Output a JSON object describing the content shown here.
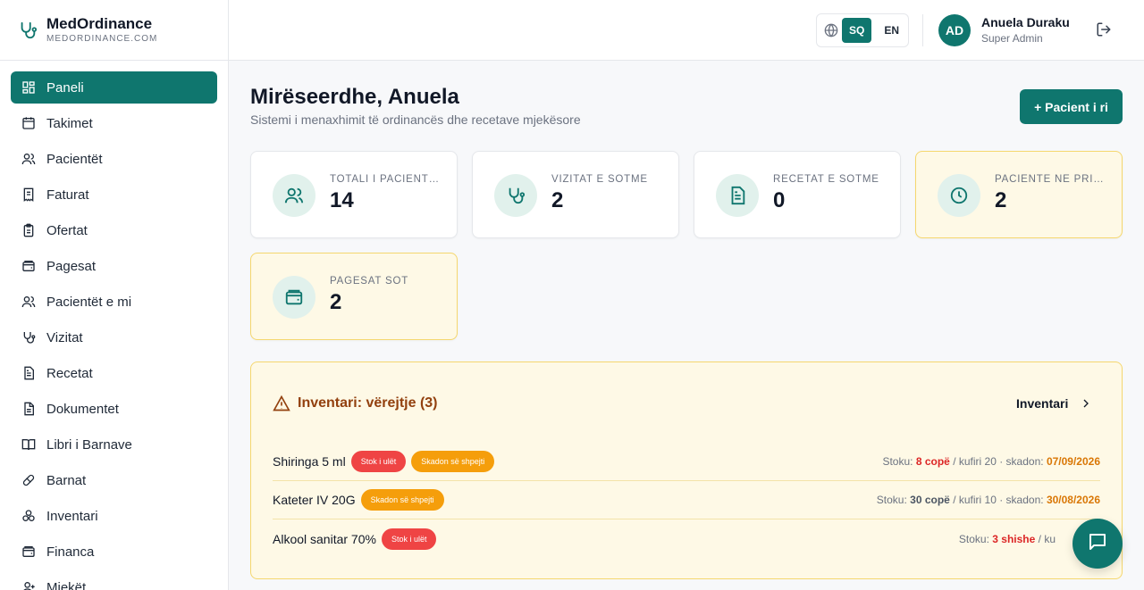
{
  "brand": {
    "name": "MedOrdinance",
    "domain": "MEDORDINANCE.COM"
  },
  "sidebar": {
    "items": [
      {
        "label": "Paneli",
        "icon": "dashboard-icon",
        "active": true
      },
      {
        "label": "Takimet",
        "icon": "calendar-icon"
      },
      {
        "label": "Pacientët",
        "icon": "users-icon"
      },
      {
        "label": "Faturat",
        "icon": "invoice-icon"
      },
      {
        "label": "Ofertat",
        "icon": "clipboard-icon"
      },
      {
        "label": "Pagesat",
        "icon": "wallet-icon"
      },
      {
        "label": "Pacientët e mi",
        "icon": "users-icon"
      },
      {
        "label": "Vizitat",
        "icon": "stethoscope-icon"
      },
      {
        "label": "Recetat",
        "icon": "document-icon"
      },
      {
        "label": "Dokumentet",
        "icon": "file-icon"
      },
      {
        "label": "Libri i Barnave",
        "icon": "book-icon"
      },
      {
        "label": "Barnat",
        "icon": "pill-icon"
      },
      {
        "label": "Inventari",
        "icon": "boxes-icon"
      },
      {
        "label": "Financa",
        "icon": "wallet-icon"
      },
      {
        "label": "Mjekët",
        "icon": "doctor-icon"
      }
    ]
  },
  "topbar": {
    "lang_active": "SQ",
    "lang_other": "EN",
    "avatar_initials": "AD",
    "user_name": "Anuela Duraku",
    "user_role": "Super Admin"
  },
  "main": {
    "welcome": "Mirëseerdhe, Anuela",
    "subtitle": "Sistemi i menaxhimit të ordinancës dhe recetave mjekësore",
    "new_patient_label": "+ Pacient i ri"
  },
  "stats": [
    {
      "label": "TOTALI I PACIENTËVE",
      "value": "14",
      "icon": "users-icon"
    },
    {
      "label": "VIZITAT E SOTME",
      "value": "2",
      "icon": "stethoscope-icon"
    },
    {
      "label": "RECETAT E SOTME",
      "value": "0",
      "icon": "document-icon"
    },
    {
      "label": "PACIENTË NË PRITJE",
      "value": "2",
      "icon": "clock-icon"
    },
    {
      "label": "PAGESAT SOT",
      "value": "2",
      "icon": "wallet-icon"
    }
  ],
  "inventory": {
    "title": "Inventari: vërejtje (3)",
    "link_label": "Inventari",
    "rows": [
      {
        "name": "Shiringa 5 ml",
        "badges": [
          "Stok i ulët",
          "Skadon së shpejti"
        ],
        "stock_label": "Stoku:",
        "qty": "8 copë",
        "limit": "/ kufiri 20 · skadon:",
        "expiry": "07/09/2026"
      },
      {
        "name": "Kateter IV 20G",
        "badges": [
          "Skadon së shpejti"
        ],
        "stock_label": "Stoku:",
        "qty": "30 copë",
        "limit": "/ kufiri 10 · skadon:",
        "expiry": "30/08/2026"
      },
      {
        "name": "Alkool sanitar 70%",
        "badges": [
          "Stok i ulët"
        ],
        "stock_label": "Stoku:",
        "qty": "3 shishe",
        "limit": "/ ku",
        "expiry": ""
      }
    ]
  },
  "colors": {
    "primary": "#0f766e",
    "warn_bg": "#fef9e6",
    "badge_red": "#ef4444",
    "badge_amber": "#f59e0b"
  }
}
